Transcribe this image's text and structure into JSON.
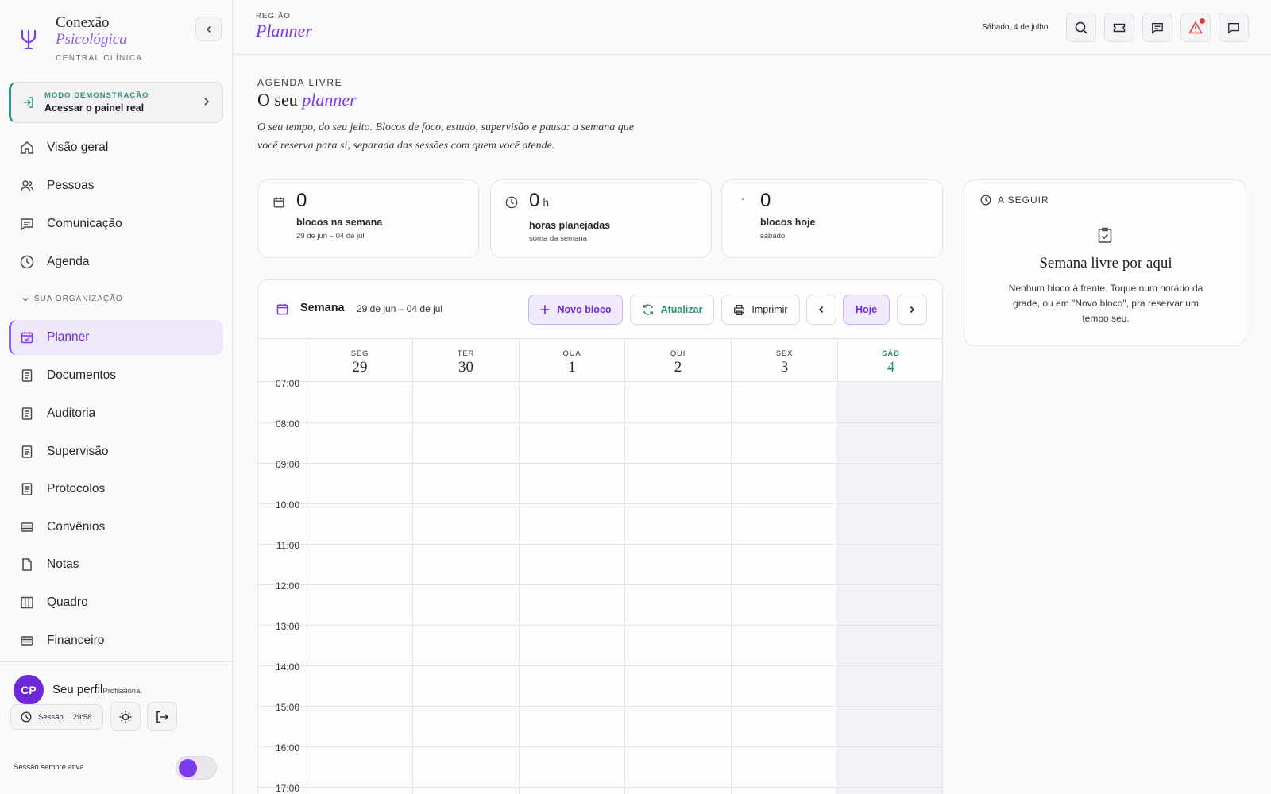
{
  "brand": {
    "line1": "Conexão",
    "line2": "Psicológica",
    "line3": "CENTRAL CLÍNICA"
  },
  "demo": {
    "kicker": "MODO DEMONSTRAÇÃO",
    "label": "Acessar o painel real"
  },
  "nav": {
    "top": [
      {
        "label": "Visão geral",
        "icon": "home-icon"
      },
      {
        "label": "Pessoas",
        "icon": "users-icon"
      },
      {
        "label": "Comunicação",
        "icon": "chat-icon"
      },
      {
        "label": "Agenda",
        "icon": "clock-icon"
      }
    ],
    "section_label": "SUA ORGANIZAÇÃO",
    "org": [
      {
        "label": "Planner",
        "icon": "calendar-check-icon",
        "active": true
      },
      {
        "label": "Documentos",
        "icon": "document-icon"
      },
      {
        "label": "Auditoria",
        "icon": "document-icon"
      },
      {
        "label": "Supervisão",
        "icon": "document-icon"
      },
      {
        "label": "Protocolos",
        "icon": "document-icon"
      },
      {
        "label": "Convênios",
        "icon": "card-icon"
      },
      {
        "label": "Notas",
        "icon": "file-icon"
      },
      {
        "label": "Quadro",
        "icon": "columns-icon"
      },
      {
        "label": "Financeiro",
        "icon": "card-icon"
      }
    ]
  },
  "profile": {
    "initials": "CP",
    "name": "Seu perfil",
    "role": "Profissional"
  },
  "session": {
    "label": "Sessão",
    "time": "29:58",
    "always_on_label": "Sessão sempre ativa",
    "always_on": true
  },
  "header": {
    "kicker": "REGIÃO",
    "title": "Planner",
    "date": "Sábado, 4 de julho"
  },
  "page": {
    "kicker": "AGENDA LIVRE",
    "title_prefix": "O seu",
    "title_accent": "planner",
    "lead": "O seu tempo, do seu jeito. Blocos de foco, estudo, supervisão e pausa: a semana que você reserva para si, separada das sessões com quem você atende."
  },
  "stats": [
    {
      "value": "0",
      "unit": "",
      "label": "blocos na semana",
      "sub": "29 de jun – 04 de jul",
      "icon": "calendar-icon"
    },
    {
      "value": "0",
      "unit": "h",
      "label": "horas planejadas",
      "sub": "soma da semana",
      "icon": "clock-icon"
    },
    {
      "value": "0",
      "unit": "",
      "label": "blocos hoje",
      "sub": "sábado",
      "icon": "dot-icon"
    }
  ],
  "next": {
    "heading": "A SEGUIR",
    "title": "Semana livre por aqui",
    "text": "Nenhum bloco à frente. Toque num horário da grade, ou em \"Novo bloco\", pra reservar um tempo seu."
  },
  "calendar": {
    "view_label": "Semana",
    "range": "29 de jun – 04 de jul",
    "new_block_label": "Novo bloco",
    "refresh_label": "Atualizar",
    "print_label": "Imprimir",
    "today_label": "Hoje",
    "days": [
      {
        "dow": "SEG",
        "num": "29"
      },
      {
        "dow": "TER",
        "num": "30"
      },
      {
        "dow": "QUA",
        "num": "1"
      },
      {
        "dow": "QUI",
        "num": "2"
      },
      {
        "dow": "SEX",
        "num": "3"
      },
      {
        "dow": "SÁB",
        "num": "4",
        "today": true
      }
    ],
    "hours": [
      "07:00",
      "08:00",
      "09:00",
      "10:00",
      "11:00",
      "12:00",
      "13:00",
      "14:00",
      "15:00",
      "16:00",
      "17:00"
    ]
  },
  "colors": {
    "accent": "#7c3aed",
    "accent_soft": "#efe8fb",
    "green": "#2f8f7a",
    "alert": "#d43a3a"
  }
}
